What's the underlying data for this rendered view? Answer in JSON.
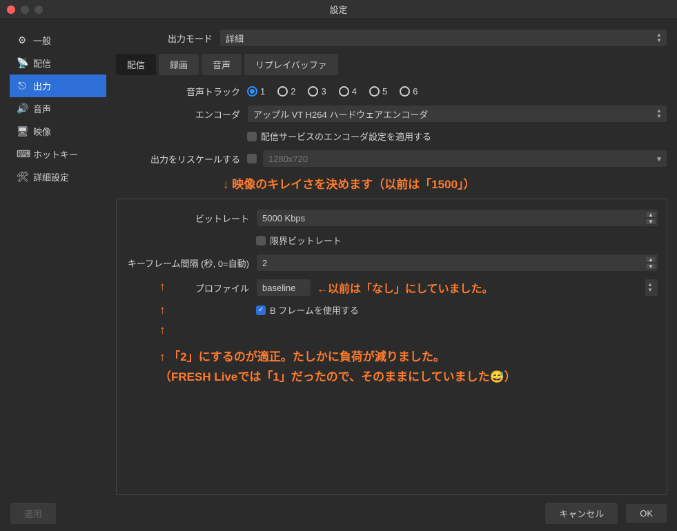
{
  "window": {
    "title": "設定"
  },
  "sidebar": {
    "items": [
      {
        "icon": "⚙",
        "label": "一般"
      },
      {
        "icon": "📡",
        "label": "配信"
      },
      {
        "icon": "⎋",
        "label": "出力"
      },
      {
        "icon": "🔊",
        "label": "音声"
      },
      {
        "icon": "🖥",
        "label": "映像"
      },
      {
        "icon": "⌨",
        "label": "ホットキー"
      },
      {
        "icon": "🛠",
        "label": "詳細設定"
      }
    ]
  },
  "outputMode": {
    "label": "出力モード",
    "value": "詳細"
  },
  "tabs": [
    "配信",
    "録画",
    "音声",
    "リプレイバッファ"
  ],
  "audioTrack": {
    "label": "音声トラック",
    "options": [
      "1",
      "2",
      "3",
      "4",
      "5",
      "6"
    ],
    "selected": "1"
  },
  "encoder": {
    "label": "エンコーダ",
    "value": "アップル VT H264 ハードウェアエンコーダ"
  },
  "enforceService": {
    "label": "配信サービスのエンコーダ設定を適用する",
    "checked": false
  },
  "rescale": {
    "label": "出力をリスケールする",
    "value": "1280x720",
    "checked": false
  },
  "bitrate": {
    "label": "ビットレート",
    "value": "5000 Kbps"
  },
  "limitBitrate": {
    "label": "限界ビットレート",
    "checked": false
  },
  "keyframe": {
    "label": "キーフレーム間隔 (秒, 0=自動)",
    "value": "2"
  },
  "profile": {
    "label": "プロファイル",
    "value": "baseline"
  },
  "bframes": {
    "label": "B フレームを使用する",
    "checked": true
  },
  "annotations": {
    "a1": "↓ 映像のキレイさを決めます（以前は「1500」）",
    "arrow_up": "↑",
    "a2": "←以前は「なし」にしていました。",
    "a3_part1": "↑ 「",
    "a3_bold": "2",
    "a3_part2": "」にするのが適正。たしかに負荷が減りました。",
    "a4": "（FRESH Liveでは「1」だったので、そのままにしていました",
    "a4_end": "）"
  },
  "footer": {
    "apply": "適用",
    "cancel": "キャンセル",
    "ok": "OK"
  }
}
